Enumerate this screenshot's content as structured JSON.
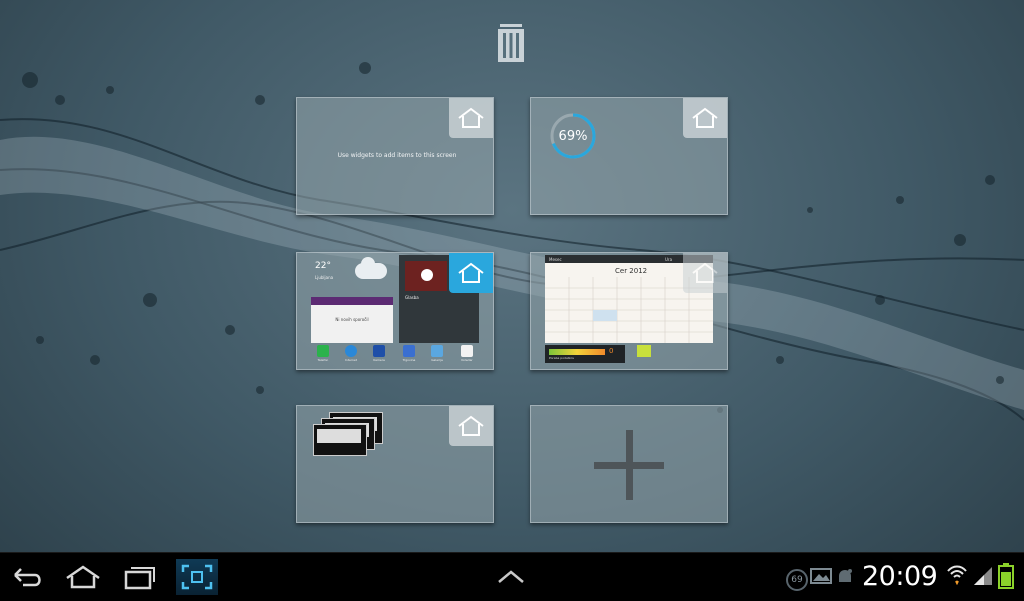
{
  "wallpaper": {
    "name": "water-splash"
  },
  "trash": {
    "icon": "trash-icon"
  },
  "panels": [
    {
      "id": "panel-1",
      "text": "Use widgets to add items to this screen",
      "home_icon": "home-icon"
    },
    {
      "id": "panel-2",
      "battery_percent": "69%",
      "battery_value": 69,
      "home_icon": "home-icon"
    },
    {
      "id": "panel-3",
      "active_home": true,
      "weather_temp": "22°",
      "weather_place": "Ljubljana",
      "email_body": "Ni novih sporočil",
      "music_title": "Glasba",
      "dock": [
        "Telefon",
        "Internet",
        "Kamera",
        "Trgovina",
        "Galerija",
        "Koledar"
      ]
    },
    {
      "id": "panel-4",
      "calendar_title": "Cer 2012",
      "calendar_left": "Mesec",
      "calendar_right": "Ura",
      "gauge_value": "0",
      "gauge_label": "Poraba podatkov"
    },
    {
      "id": "panel-5",
      "home_icon": "home-icon"
    },
    {
      "id": "panel-6",
      "add_icon": "plus-icon"
    }
  ],
  "navbar": {
    "back_icon": "back-icon",
    "home_icon": "home-icon",
    "recent_icon": "recent-apps-icon",
    "screenshot_icon": "screenshot-capture-icon",
    "up_icon": "chevron-up-icon",
    "notification_count": "69",
    "clock": "20:09",
    "battery_color": "#8bd12a",
    "accent": "#2aa7dd"
  }
}
